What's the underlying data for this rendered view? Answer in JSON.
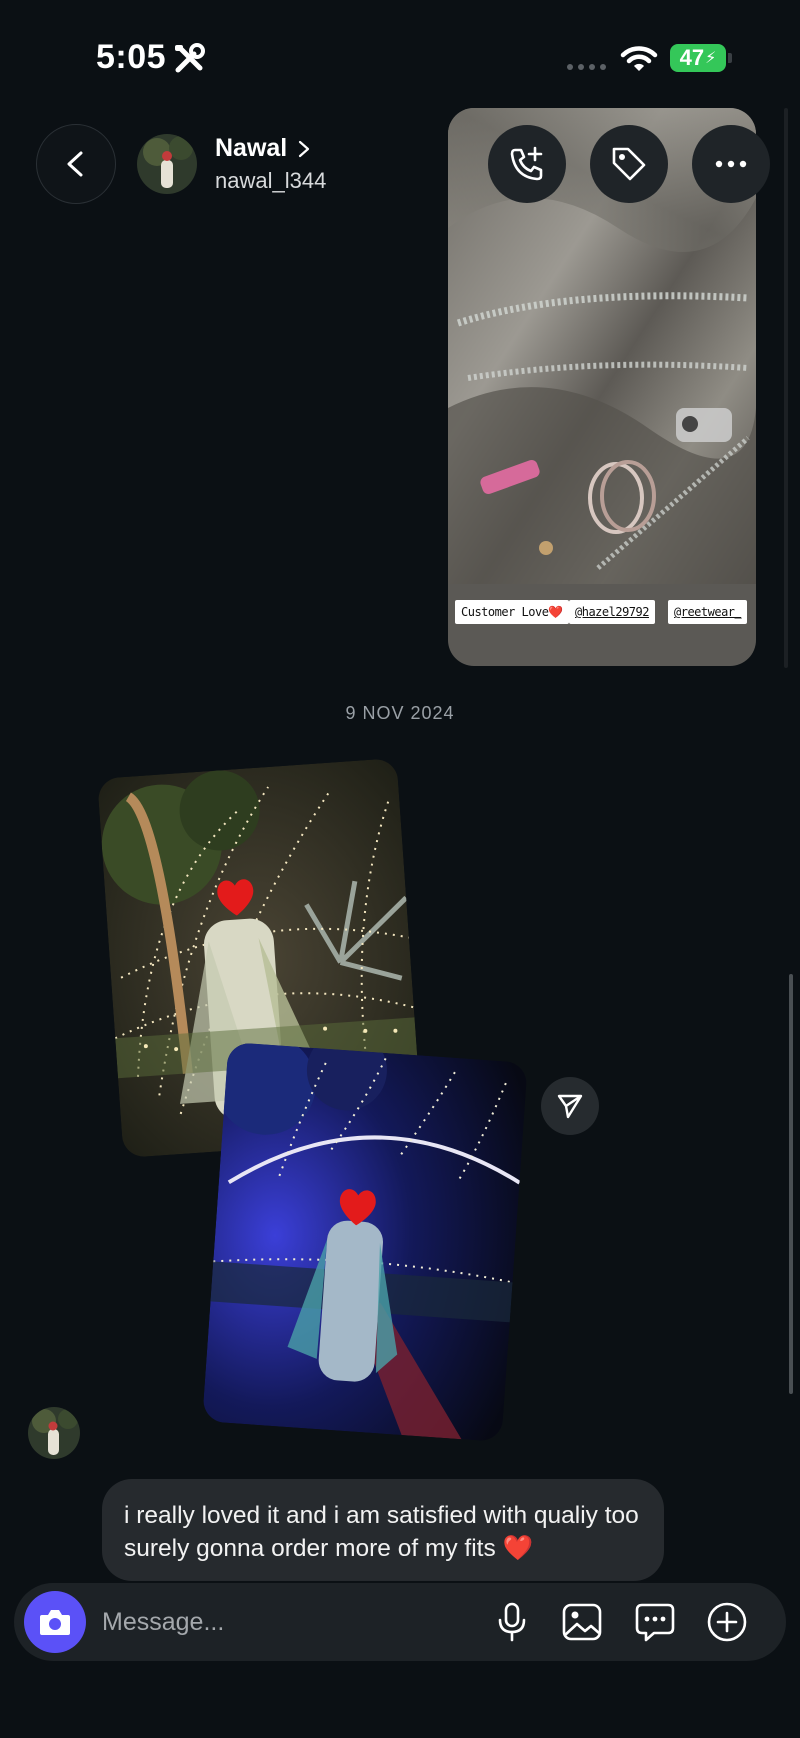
{
  "status_bar": {
    "time": "5:05",
    "battery": "47"
  },
  "header": {
    "name": "Nawal",
    "username": "nawal_l344"
  },
  "shared_post": {
    "tags": [
      "Customer Love❤️",
      "@hazel29792",
      "@reetwear_"
    ]
  },
  "date_divider": "9 NOV 2024",
  "message": {
    "text": "i really loved it and i am satisfied with qualiy too surely gonna order more of my fits ❤️"
  },
  "composer": {
    "placeholder": "Message..."
  },
  "colors": {
    "background": "#0b1014",
    "bubble": "#262a2e",
    "camera_accent": "#5b51f7",
    "battery_green": "#34c759"
  }
}
